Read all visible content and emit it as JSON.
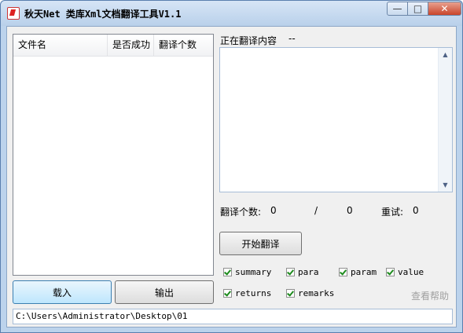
{
  "window": {
    "title": "秋天Net 类库Xml文档翻译工具V1.1",
    "buttons": {
      "minimize": "—",
      "maximize": "□",
      "close": "✕"
    }
  },
  "file_list": {
    "columns": [
      "文件名",
      "是否成功",
      "翻译个数"
    ],
    "rows": []
  },
  "translating": {
    "label": "正在翻译内容",
    "value": "--"
  },
  "stats": {
    "count_label": "翻译个数:",
    "count_value": "0",
    "separator": "/",
    "total_value": "0",
    "retry_label": "重试:",
    "retry_value": "0"
  },
  "buttons": {
    "start": "开始翻译",
    "load": "载入",
    "output": "输出"
  },
  "options": [
    {
      "label": "summary",
      "checked": true
    },
    {
      "label": "para",
      "checked": true
    },
    {
      "label": "param",
      "checked": true
    },
    {
      "label": "value",
      "checked": true
    },
    {
      "label": "returns",
      "checked": true
    },
    {
      "label": "remarks",
      "checked": true
    }
  ],
  "help_link": "查看帮助",
  "path": "C:\\Users\\Administrator\\Desktop\\01",
  "colors": {
    "title_bar": "#b9d0ea",
    "close_button": "#c9452b",
    "help_text": "#a0a0a0",
    "checkmark": "#1c8a1c"
  }
}
